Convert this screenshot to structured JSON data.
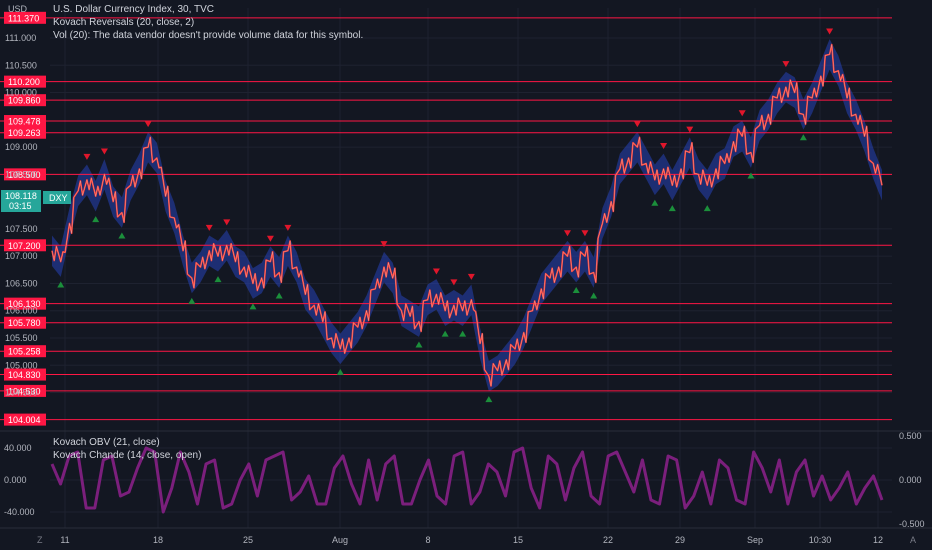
{
  "header": {
    "currency_label": "USD",
    "title": "U.S. Dollar Currency Index, 30, TVC",
    "indicator_1": "Kovach Reversals (20, close, 2)",
    "indicator_2": "Vol (20): The data vendor doesn't provide volume data for this symbol."
  },
  "price_badge": {
    "price": "108.118",
    "symbol": "DXY",
    "countdown": "03:15",
    "color": "#26a69a"
  },
  "lower_pane": {
    "indicator_1": "Kovach OBV (21, close)",
    "indicator_2": "Kovach Chande (14, close, open)"
  },
  "footer": {
    "left_icon": "Z",
    "right_icon": "A"
  },
  "colors": {
    "background": "#131722",
    "level_line": "#ff1744",
    "candle_line": "#ff3b30",
    "band": "#2b4bd6",
    "buy_marker": "#1b8f3b",
    "sell_marker": "#e0162b",
    "oscillator": "#7b1f7c"
  },
  "chart_data": [
    {
      "type": "line",
      "series": [
        {
          "values": [
            107.1,
            106.9,
            107.6,
            108.2,
            108.4,
            108.1,
            108.5,
            108.0,
            107.8,
            108.3,
            108.6,
            109.0,
            108.8,
            108.1,
            107.7,
            107.1,
            106.6,
            106.8,
            107.1,
            107.0,
            107.2,
            106.9,
            106.8,
            106.5,
            106.6,
            106.9,
            106.7,
            107.1,
            106.8,
            106.3,
            106.1,
            105.8,
            105.5,
            105.3,
            105.5,
            105.7,
            106.0,
            106.4,
            106.8,
            106.6,
            106.0,
            105.9,
            105.8,
            106.2,
            106.3,
            106.0,
            106.1,
            106.0,
            106.2,
            105.4,
            104.8,
            104.9,
            105.1,
            105.3,
            105.6,
            106.0,
            106.4,
            106.6,
            106.8,
            107.0,
            106.8,
            107.0,
            106.7,
            107.6,
            108.0,
            108.6,
            108.8,
            109.0,
            108.7,
            108.4,
            108.6,
            108.3,
            108.6,
            108.9,
            108.5,
            108.3,
            108.6,
            108.7,
            109.1,
            109.2,
            108.9,
            109.4,
            109.6,
            109.9,
            110.1,
            110.0,
            109.6,
            109.9,
            110.3,
            110.7,
            110.4,
            109.9,
            109.6,
            109.2,
            108.7,
            108.3
          ]
        }
      ],
      "y_ticks": [
        "111.000",
        "110.500",
        "110.000",
        "109.000",
        "108.500",
        "107.500",
        "107.000",
        "106.500",
        "106.000",
        "105.500",
        "105.000",
        "104.500"
      ],
      "x_ticks": [
        "11",
        "18",
        "25",
        "Aug",
        "8",
        "15",
        "22",
        "29",
        "Sep",
        "10:30",
        "12"
      ],
      "ylim": [
        103.85,
        111.55
      ],
      "horizontal_levels": [
        "111.370",
        "110.200",
        "109.860",
        "109.478",
        "109.263",
        "108.500",
        "107.200",
        "106.130",
        "105.780",
        "105.258",
        "104.830",
        "104.530",
        "104.004"
      ],
      "last_price": "108.118"
    },
    {
      "type": "line",
      "series": [
        {
          "values": [
            20,
            -5,
            30,
            35,
            -35,
            -35,
            25,
            30,
            -20,
            -15,
            15,
            40,
            35,
            -40,
            -10,
            35,
            10,
            -30,
            20,
            25,
            -35,
            -30,
            0,
            20,
            -20,
            25,
            30,
            35,
            -25,
            -15,
            5,
            -30,
            -30,
            15,
            30,
            -5,
            -30,
            25,
            -25,
            20,
            30,
            -30,
            -30,
            0,
            25,
            -20,
            -30,
            30,
            35,
            -30,
            -15,
            20,
            10,
            -20,
            35,
            40,
            -10,
            -35,
            30,
            20,
            -25,
            15,
            35,
            -20,
            -30,
            30,
            35,
            10,
            -15,
            25,
            -25,
            -30,
            30,
            25,
            -35,
            -20,
            10,
            -30,
            25,
            15,
            -25,
            -30,
            35,
            15,
            -15,
            25,
            -30,
            10,
            25,
            -20,
            5,
            -25,
            -10,
            10,
            -30,
            -10,
            5,
            -25
          ]
        }
      ],
      "y_ticks_left": [
        "40.000",
        "0.000",
        "-40.000"
      ],
      "y_ticks_right": [
        "0.500",
        "0.000",
        "-0.500"
      ],
      "ylim": [
        -55,
        55
      ]
    }
  ]
}
